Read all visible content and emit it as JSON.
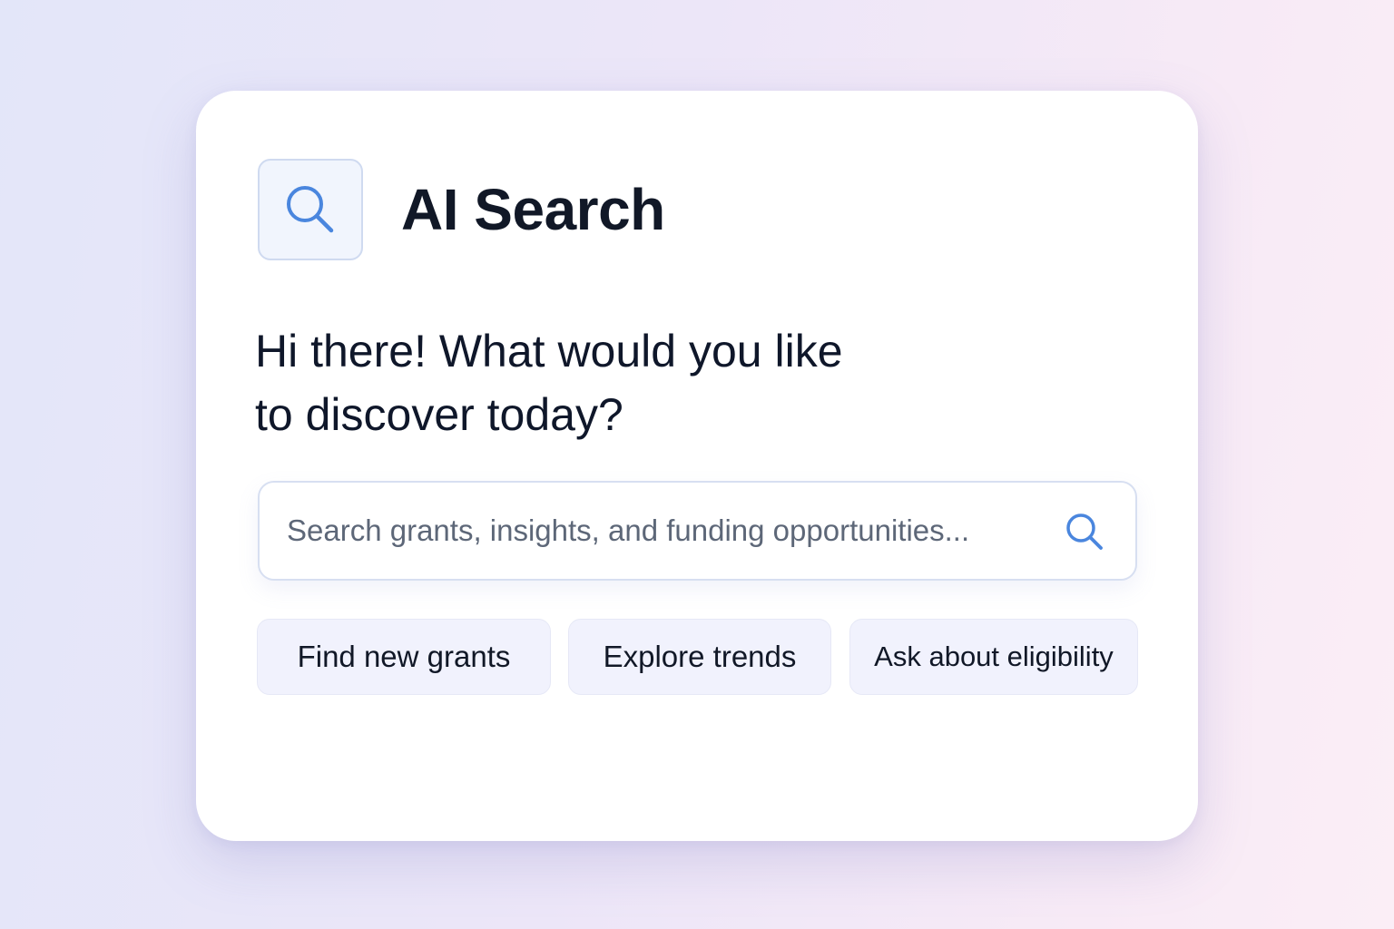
{
  "app": {
    "title": "AI Search",
    "logo_icon": "search-icon"
  },
  "greeting": {
    "line1": "Hi there! What would you like",
    "line2": "to discover today?"
  },
  "search": {
    "placeholder": "Search grants, insights, and funding opportunities...",
    "value": "",
    "submit_icon": "search-icon"
  },
  "suggestions": [
    {
      "label": "Find new grants"
    },
    {
      "label": "Explore trends"
    },
    {
      "label": "Ask about eligibility"
    }
  ],
  "colors": {
    "accent": "#4a86de",
    "text": "#111827",
    "chip_background": "#f1f2fd",
    "card_background": "#ffffff"
  }
}
